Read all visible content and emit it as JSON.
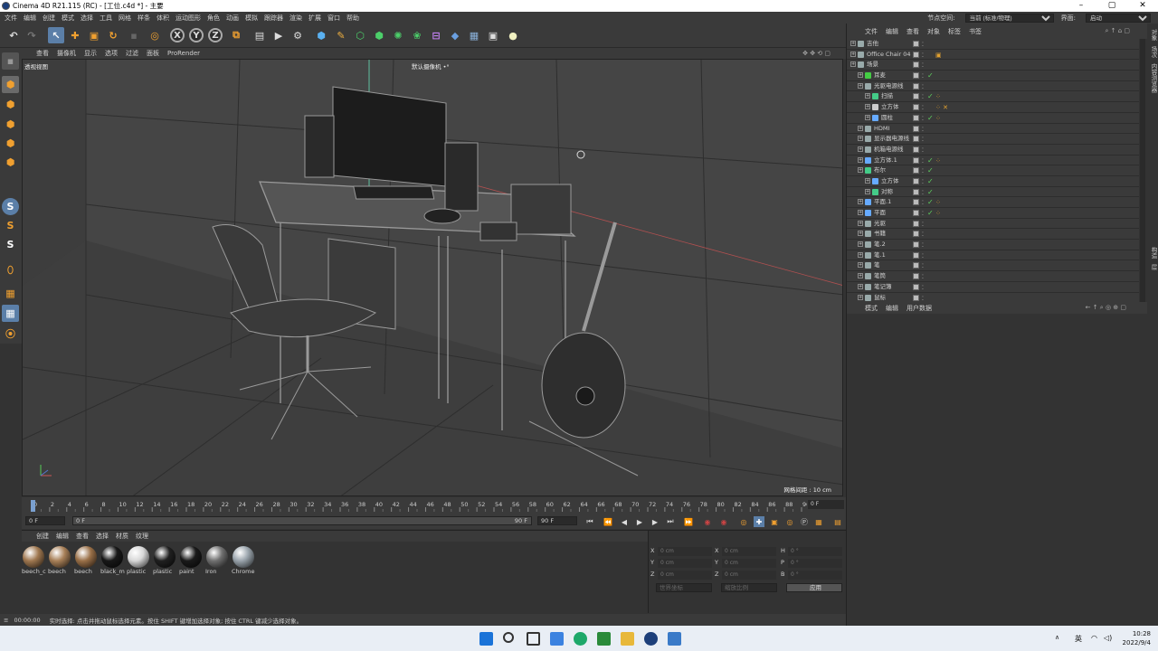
{
  "window": {
    "title": "Cinema 4D R21.115 (RC) - [工位.c4d *] - 主要"
  },
  "menu": {
    "items": [
      "文件",
      "编辑",
      "创建",
      "模式",
      "选择",
      "工具",
      "网格",
      "样条",
      "体积",
      "运动图形",
      "角色",
      "动画",
      "模拟",
      "跟踪器",
      "渲染",
      "扩展",
      "窗口",
      "帮助"
    ],
    "node_space_label": "节点空间:",
    "node_space_value": "当前 (标准/物理)",
    "layout_label": "界面:",
    "layout_value": "启动"
  },
  "viewport": {
    "menu": [
      "查看",
      "摄像机",
      "显示",
      "选项",
      "过滤",
      "面板",
      "ProRender"
    ],
    "label": "透视视图",
    "camera": "默认摄像机 •°",
    "grid_spacing": "网格间距 : 10 cm"
  },
  "timeline": {
    "ticks": [
      "0",
      "2",
      "4",
      "6",
      "8",
      "10",
      "12",
      "14",
      "16",
      "18",
      "20",
      "22",
      "24",
      "26",
      "28",
      "30",
      "32",
      "34",
      "36",
      "38",
      "40",
      "42",
      "44",
      "46",
      "48",
      "50",
      "52",
      "54",
      "56",
      "58",
      "60",
      "62",
      "64",
      "66",
      "68",
      "70",
      "72",
      "74",
      "76",
      "78",
      "80",
      "82",
      "84",
      "86",
      "88",
      "90"
    ],
    "current_frame": "0 F"
  },
  "animation": {
    "start": "0 F",
    "min": "0 F",
    "max": "90 F",
    "end": "90 F"
  },
  "material_manager": {
    "menu": [
      "创建",
      "编辑",
      "查看",
      "选择",
      "材质",
      "纹理"
    ],
    "materials": [
      {
        "name": "beech_c",
        "color": "#a07850"
      },
      {
        "name": "beech",
        "color": "#a88058"
      },
      {
        "name": "beech",
        "color": "#9a7048"
      },
      {
        "name": "black_m",
        "color": "#181818"
      },
      {
        "name": "plastic",
        "color": "#d8d8d8"
      },
      {
        "name": "plastic",
        "color": "#202020"
      },
      {
        "name": "paint",
        "color": "#1a1a1a"
      },
      {
        "name": "Iron",
        "color": "#707070"
      },
      {
        "name": "Chrome",
        "color": "#9aa4ac"
      }
    ]
  },
  "coordinates": {
    "rows": [
      {
        "a": "X",
        "av": "0 cm",
        "b": "X",
        "bv": "0 cm",
        "c": "H",
        "cv": "0 °"
      },
      {
        "a": "Y",
        "av": "0 cm",
        "b": "Y",
        "bv": "0 cm",
        "c": "P",
        "cv": "0 °"
      },
      {
        "a": "Z",
        "av": "0 cm",
        "b": "Z",
        "bv": "0 cm",
        "c": "B",
        "cv": "0 °"
      }
    ],
    "world": "世界坐标",
    "scale": "缩放比例",
    "apply": "应用"
  },
  "status": {
    "time": "00:00:00",
    "text": "实时选择: 点击并拖动鼠标选择元素。按住 SHIFT 键增加选择对象; 按住 CTRL 键减少选择对象。"
  },
  "object_manager": {
    "menu": [
      "文件",
      "编辑",
      "查看",
      "对象",
      "标签",
      "书签"
    ],
    "objects": [
      {
        "name": "吉他",
        "indent": 0,
        "icon": "#9aa"
      },
      {
        "name": "Office Chair 04",
        "indent": 0,
        "icon": "#9aa",
        "tag": "▣"
      },
      {
        "name": "场景",
        "indent": 0,
        "icon": "#9aa"
      },
      {
        "name": "耳麦",
        "indent": 1,
        "icon": "#4c4",
        "check": "✓"
      },
      {
        "name": "光驱电源线",
        "indent": 1,
        "icon": "#9aa"
      },
      {
        "name": "扫描",
        "indent": 2,
        "icon": "#4c8",
        "check": "✓",
        "tag": "⁘"
      },
      {
        "name": "立方体",
        "indent": 2,
        "icon": "#ccc",
        "tag": "⁘ ✕"
      },
      {
        "name": "圆柱",
        "indent": 2,
        "icon": "#6af",
        "check": "✓",
        "tag": "⁘"
      },
      {
        "name": "HDMI",
        "indent": 1,
        "icon": "#9aa"
      },
      {
        "name": "显示器电源线",
        "indent": 1,
        "icon": "#9aa"
      },
      {
        "name": "机箱电源线",
        "indent": 1,
        "icon": "#9aa"
      },
      {
        "name": "立方体.1",
        "indent": 1,
        "icon": "#6af",
        "check": "✓",
        "tag": "⁘"
      },
      {
        "name": "布尔",
        "indent": 1,
        "icon": "#4c8",
        "check": "✓"
      },
      {
        "name": "立方体",
        "indent": 2,
        "icon": "#6af",
        "check": "✓"
      },
      {
        "name": "对称",
        "indent": 2,
        "icon": "#4c8",
        "check": "✓"
      },
      {
        "name": "平面.1",
        "indent": 1,
        "icon": "#6af",
        "check": "✓",
        "tag": "⁘"
      },
      {
        "name": "平面",
        "indent": 1,
        "icon": "#6af",
        "check": "✓",
        "tag": "⁘"
      },
      {
        "name": "光驱",
        "indent": 1,
        "icon": "#9aa"
      },
      {
        "name": "书籍",
        "indent": 1,
        "icon": "#9aa"
      },
      {
        "name": "笔.2",
        "indent": 1,
        "icon": "#9aa"
      },
      {
        "name": "笔.1",
        "indent": 1,
        "icon": "#9aa"
      },
      {
        "name": "笔",
        "indent": 1,
        "icon": "#9aa"
      },
      {
        "name": "笔筒",
        "indent": 1,
        "icon": "#9aa"
      },
      {
        "name": "笔记簿",
        "indent": 1,
        "icon": "#9aa"
      },
      {
        "name": "鼠标",
        "indent": 1,
        "icon": "#9aa"
      }
    ]
  },
  "attribute_manager": {
    "menu": [
      "模式",
      "编辑",
      "用户数据"
    ]
  },
  "side_tabs": [
    "对象",
    "场次",
    "内容浏览器",
    "构造",
    "层"
  ],
  "taskbar": {
    "lang": "英",
    "time": "10:28",
    "date": "2022/9/4"
  }
}
